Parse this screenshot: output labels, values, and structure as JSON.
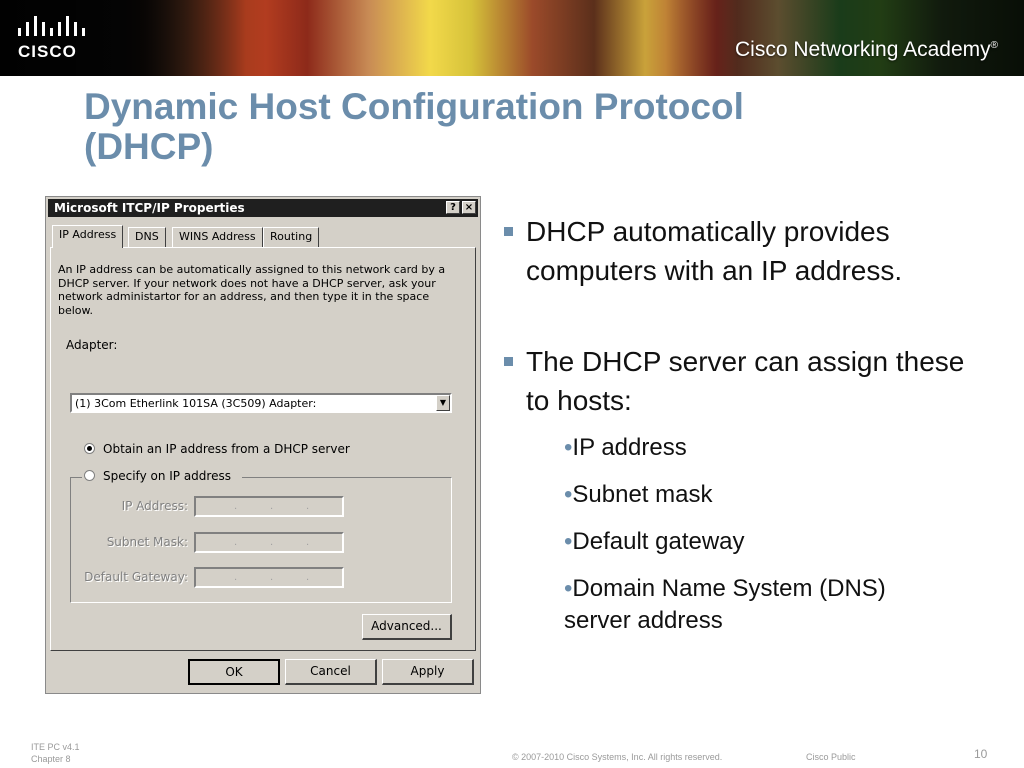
{
  "banner": {
    "logo_word": "CISCO",
    "academy": "Cisco Networking Academy",
    "trademark": "®"
  },
  "slide": {
    "title_line1": "Dynamic Host Configuration Protocol",
    "title_line2": "(DHCP)"
  },
  "dialog": {
    "title": "Microsoft ITCP/IP Properties",
    "help_glyph": "?",
    "close_glyph": "×",
    "tabs": [
      {
        "label": "IP Address"
      },
      {
        "label": "DNS"
      },
      {
        "label": "WINS Address"
      },
      {
        "label": "Routing"
      }
    ],
    "intro_text": "An IP address can be automatically assigned to this network card by a DHCP server. If your network does not have a DHCP server, ask your network administartor for an address, and then type it in the space below.",
    "adapter_label": "Adapter:",
    "adapter_value": "(1) 3Com Etherlink 101SA (3C509) Adapter:",
    "adapter_arrow": "▼",
    "radio_dhcp": "Obtain an IP address from a DHCP server",
    "radio_specify": "Specify on IP address",
    "radio_dhcp_selected": true,
    "fields": {
      "ip_label": "IP Address:",
      "mask_label": "Subnet Mask:",
      "gateway_label": "Default Gateway:",
      "separator": "."
    },
    "buttons": {
      "advanced": "Advanced...",
      "ok": "OK",
      "cancel": "Cancel",
      "apply": "Apply"
    }
  },
  "bullets": {
    "item1": "DHCP automatically provides computers with an IP address.",
    "item2": "The DHCP server can assign these to hosts:",
    "sub_marker": "•",
    "sub_items": [
      "IP address",
      "Subnet mask",
      "Default gateway",
      "Domain Name System (DNS)"
    ],
    "sub_item4_cont": "server address"
  },
  "footer": {
    "course_line1": "ITE PC v4.1",
    "course_line2": "Chapter 8",
    "copyright": "© 2007-2010 Cisco Systems, Inc. All rights reserved.",
    "classification": "Cisco Public",
    "page": "10"
  },
  "colors": {
    "title": "#6b8dab",
    "bullet": "#6b8dab",
    "footer": "#9a9a9a",
    "dialog_bg": "#d4d0c8"
  }
}
